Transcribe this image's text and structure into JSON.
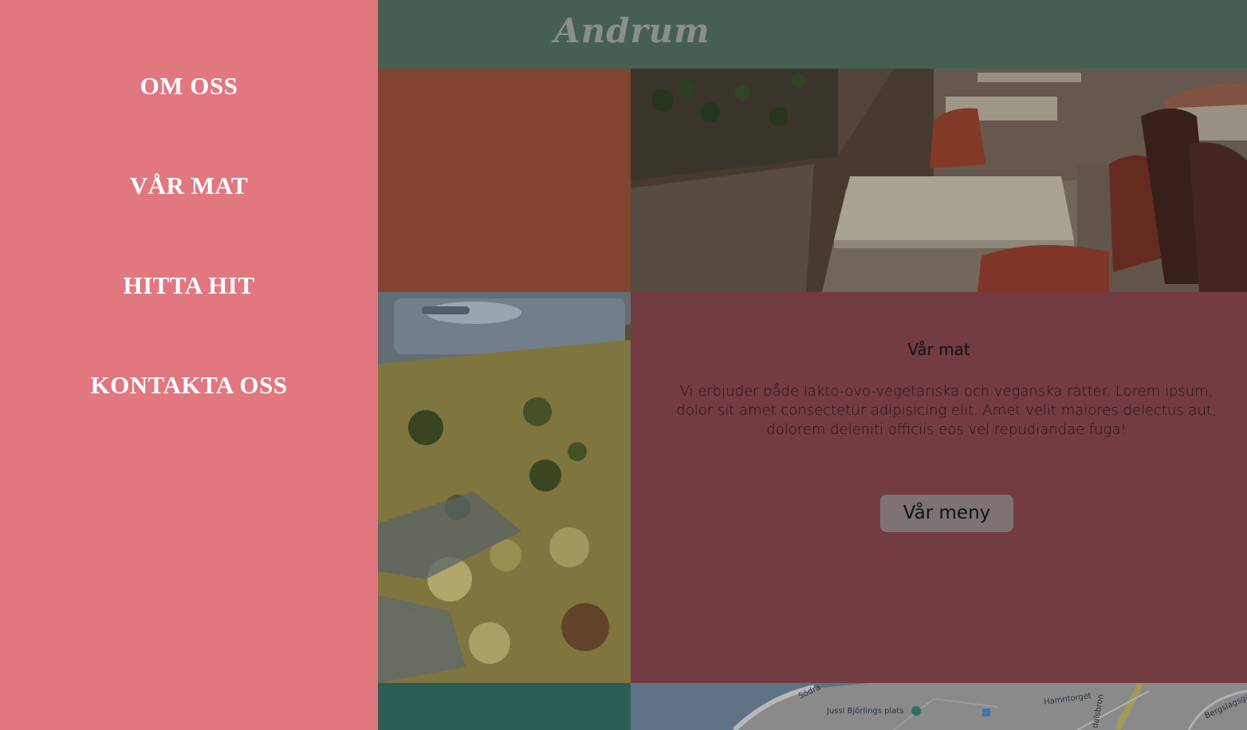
{
  "sidebar": {
    "items": [
      {
        "label": "OM OSS"
      },
      {
        "label": "VÅR MAT"
      },
      {
        "label": "HITTA HIT"
      },
      {
        "label": "KONTAKTA OSS"
      }
    ]
  },
  "header": {
    "logo": "Andrum"
  },
  "food_section": {
    "title": "Vår mat",
    "body": "Vi erbjuder både lakto-ovo-vegetariska och veganska rätter. Lorem ipsum, dolor sit amet consectetur adipisicing elit. Amet velit maiores delectus aut, dolorem deleniti officiis eos vel repudiandae fuga!",
    "button_label": "Vår meny"
  },
  "map": {
    "place_label": "Jussi Björlings plats",
    "street_label_1": "Hamntorget",
    "street_label_2": "Bergslagsga",
    "street_label_3": "Södra",
    "street_label_4": "dalsbron"
  },
  "colors": {
    "sidebar": "#e1777f",
    "header": "#465f53",
    "rust": "#82452f",
    "panel": "#733b42",
    "teal": "#2d5e55"
  }
}
